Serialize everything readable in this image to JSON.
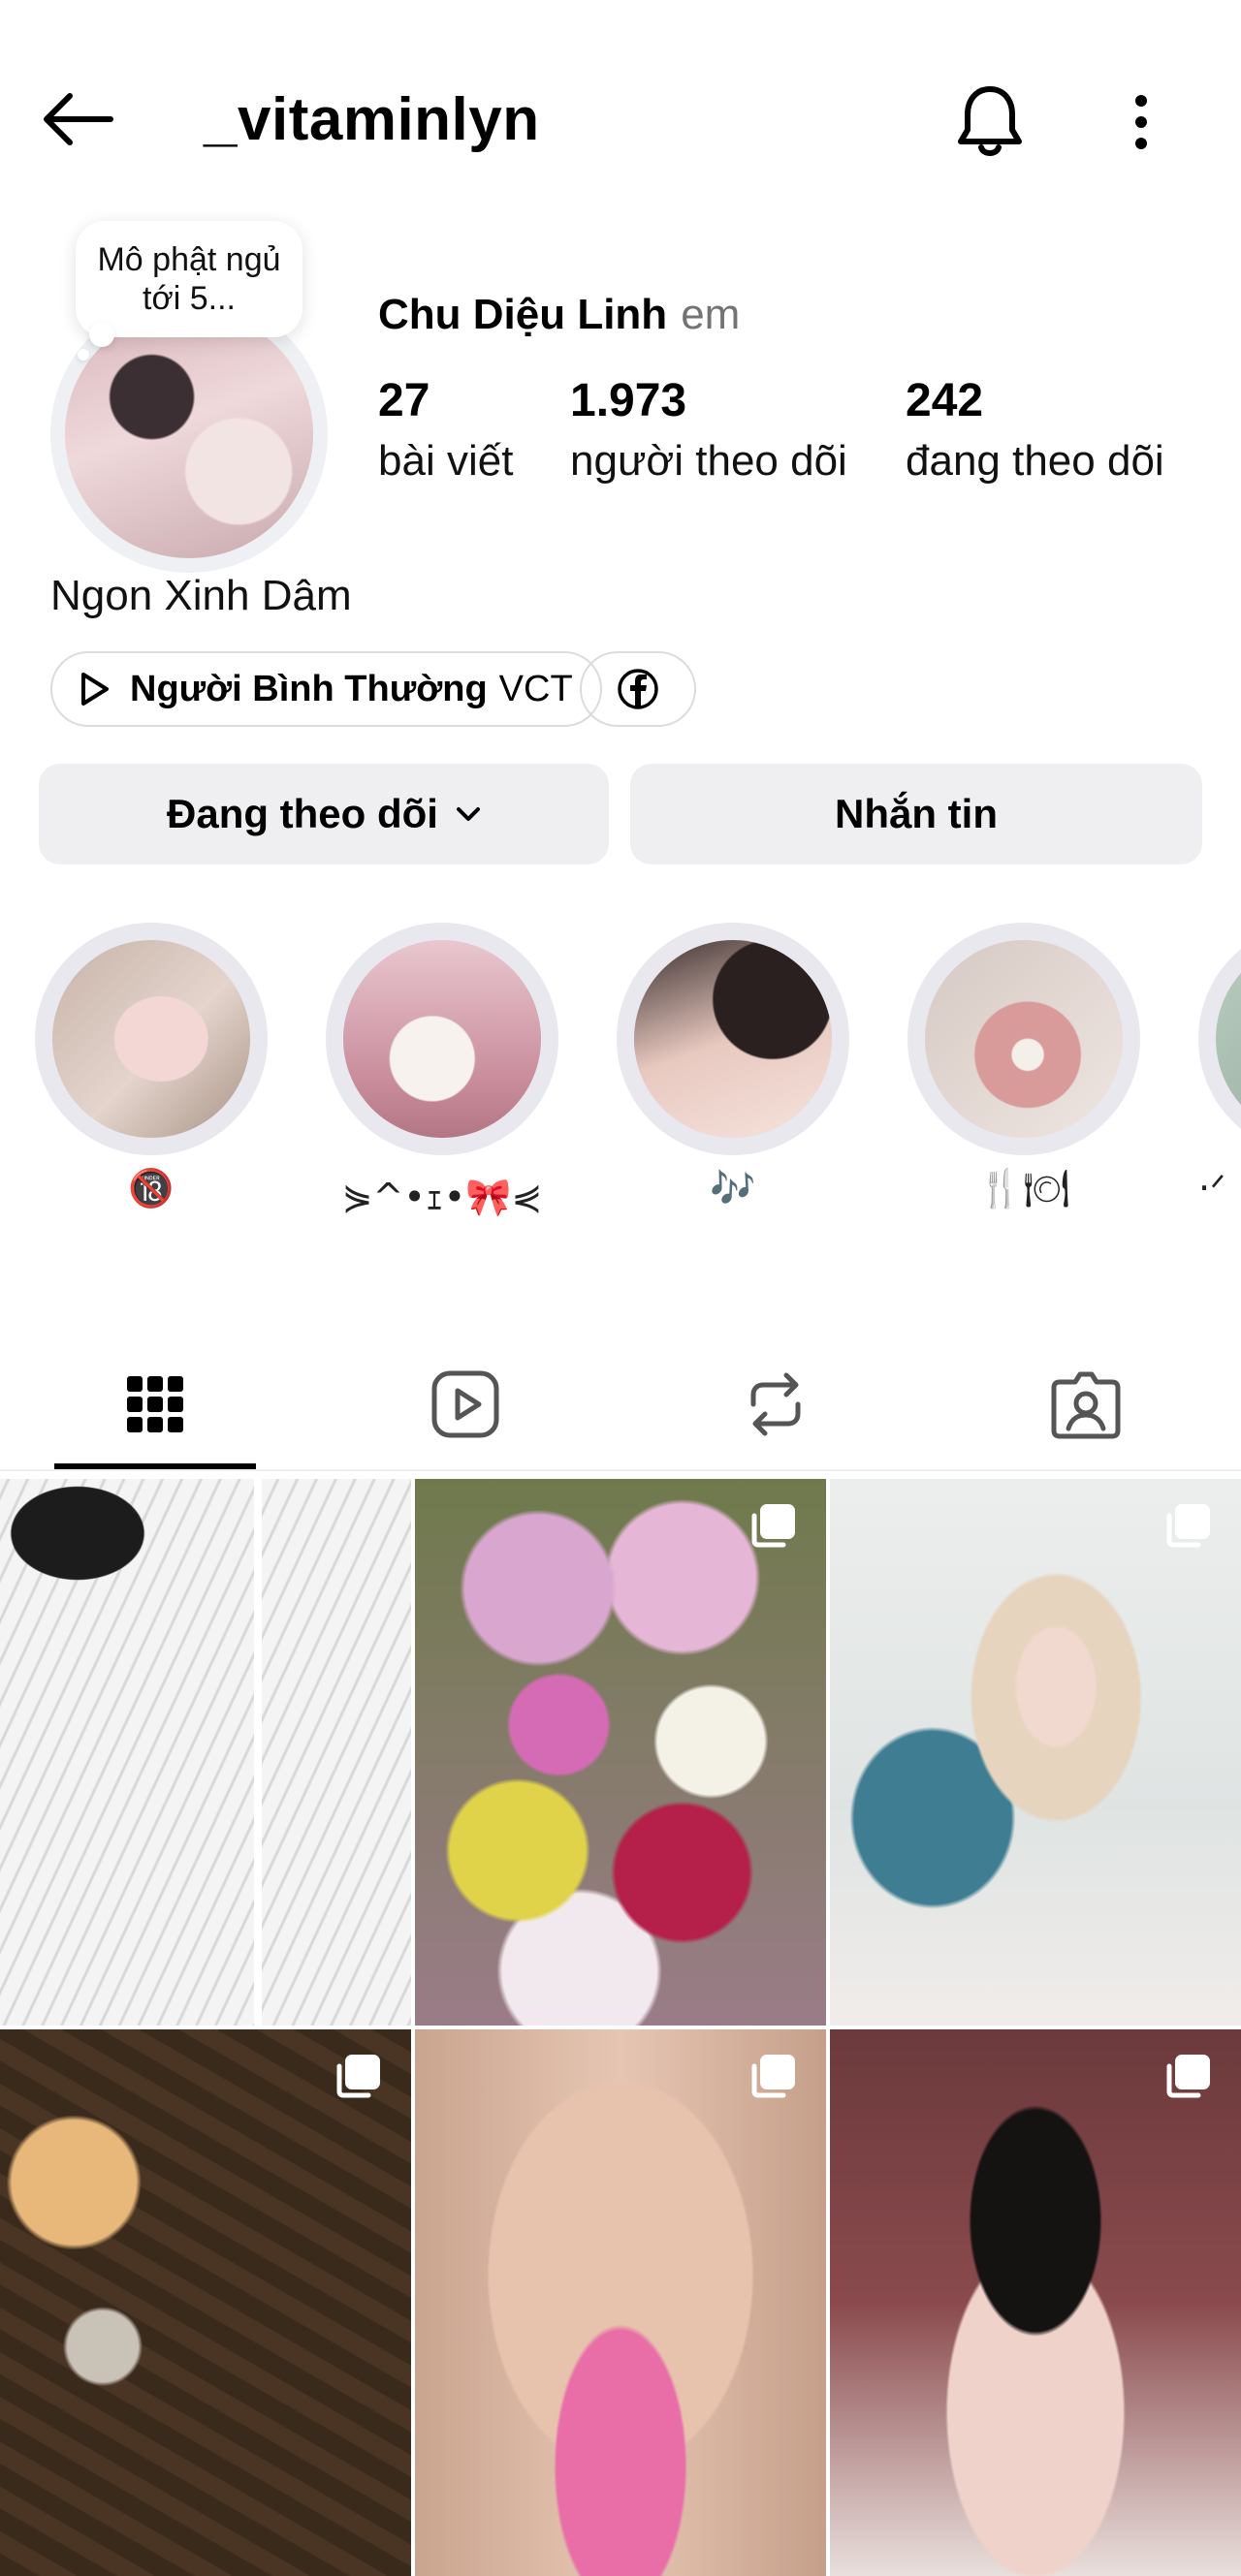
{
  "header": {
    "username": "_vitaminlyn",
    "icons": [
      "back-arrow-icon",
      "bell-icon",
      "more-vertical-icon"
    ]
  },
  "profile": {
    "note": "Mô phật ngủ tới 5...",
    "full_name": "Chu Diệu Linh",
    "pronoun": "em",
    "stats": [
      {
        "value": "27",
        "label": "bài viết"
      },
      {
        "value": "1.973",
        "label": "người theo dõi"
      },
      {
        "value": "242",
        "label": "đang theo dõi"
      }
    ],
    "bio": "Ngon Xinh Dâm",
    "link": {
      "bold": "Người Bình Thường",
      "regular": "VCT"
    },
    "facebook_icon": "facebook-icon"
  },
  "actions": {
    "following": "Đang theo dõi",
    "message": "Nhắn tin"
  },
  "highlights": [
    {
      "label": "🔞"
    },
    {
      "label": "⋟^•ｪ•🎀⋞"
    },
    {
      "label": "🎶"
    },
    {
      "label": "🍴🍽"
    },
    {
      "label": "·ᐟ"
    }
  ],
  "tabs": [
    {
      "name": "grid-icon"
    },
    {
      "name": "reels-icon"
    },
    {
      "name": "reposts-icon"
    },
    {
      "name": "tagged-icon"
    }
  ],
  "colors": {
    "button_bg": "#efeff2",
    "secondary_text": "#737373",
    "ring": "#e8e8ee"
  }
}
